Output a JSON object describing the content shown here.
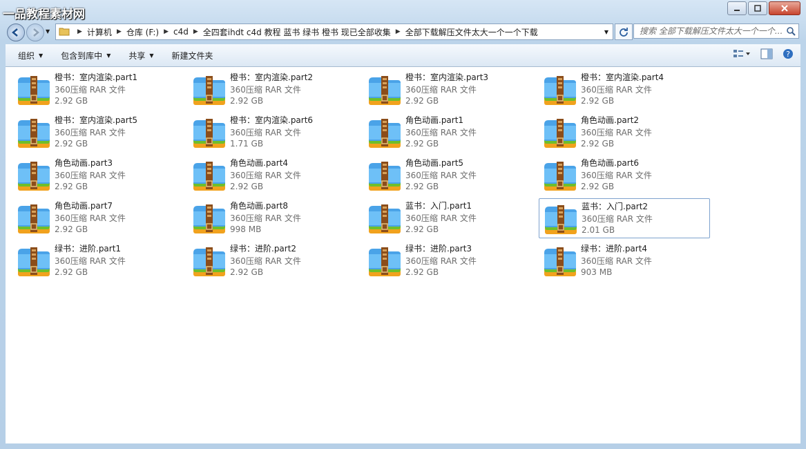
{
  "watermark": "一品教程素材网",
  "address": {
    "crumbs": [
      "计算机",
      "仓库 (F:)",
      "c4d",
      "全四套ihdt c4d 教程 蓝书 绿书 橙书  现已全部收集",
      "全部下载解压文件太大一个一个下载"
    ]
  },
  "search": {
    "placeholder": "搜索 全部下载解压文件太大一个一个..."
  },
  "toolbar": {
    "organize": "组织",
    "include": "包含到库中",
    "share": "共享",
    "new_folder": "新建文件夹"
  },
  "colors": {
    "accent": "#3b8ad8",
    "selected_border": "#7da2ce"
  },
  "files": [
    {
      "name": "橙书：室内渲染.part1",
      "type": "360压缩 RAR 文件",
      "size": "2.92 GB"
    },
    {
      "name": "橙书：室内渲染.part2",
      "type": "360压缩 RAR 文件",
      "size": "2.92 GB"
    },
    {
      "name": "橙书：室内渲染.part3",
      "type": "360压缩 RAR 文件",
      "size": "2.92 GB"
    },
    {
      "name": "橙书：室内渲染.part4",
      "type": "360压缩 RAR 文件",
      "size": "2.92 GB"
    },
    {
      "name": "橙书：室内渲染.part5",
      "type": "360压缩 RAR 文件",
      "size": "2.92 GB"
    },
    {
      "name": "橙书：室内渲染.part6",
      "type": "360压缩 RAR 文件",
      "size": "1.71 GB"
    },
    {
      "name": "角色动画.part1",
      "type": "360压缩 RAR 文件",
      "size": "2.92 GB"
    },
    {
      "name": "角色动画.part2",
      "type": "360压缩 RAR 文件",
      "size": "2.92 GB"
    },
    {
      "name": "角色动画.part3",
      "type": "360压缩 RAR 文件",
      "size": "2.92 GB"
    },
    {
      "name": "角色动画.part4",
      "type": "360压缩 RAR 文件",
      "size": "2.92 GB"
    },
    {
      "name": "角色动画.part5",
      "type": "360压缩 RAR 文件",
      "size": "2.92 GB"
    },
    {
      "name": "角色动画.part6",
      "type": "360压缩 RAR 文件",
      "size": "2.92 GB"
    },
    {
      "name": "角色动画.part7",
      "type": "360压缩 RAR 文件",
      "size": "2.92 GB"
    },
    {
      "name": "角色动画.part8",
      "type": "360压缩 RAR 文件",
      "size": "998 MB"
    },
    {
      "name": "蓝书：入门.part1",
      "type": "360压缩 RAR 文件",
      "size": "2.92 GB"
    },
    {
      "name": "蓝书：入门.part2",
      "type": "360压缩 RAR 文件",
      "size": "2.01 GB",
      "selected": true
    },
    {
      "name": "绿书：进阶.part1",
      "type": "360压缩 RAR 文件",
      "size": "2.92 GB"
    },
    {
      "name": "绿书：进阶.part2",
      "type": "360压缩 RAR 文件",
      "size": "2.92 GB"
    },
    {
      "name": "绿书：进阶.part3",
      "type": "360压缩 RAR 文件",
      "size": "2.92 GB"
    },
    {
      "name": "绿书：进阶.part4",
      "type": "360压缩 RAR 文件",
      "size": "903 MB"
    }
  ]
}
